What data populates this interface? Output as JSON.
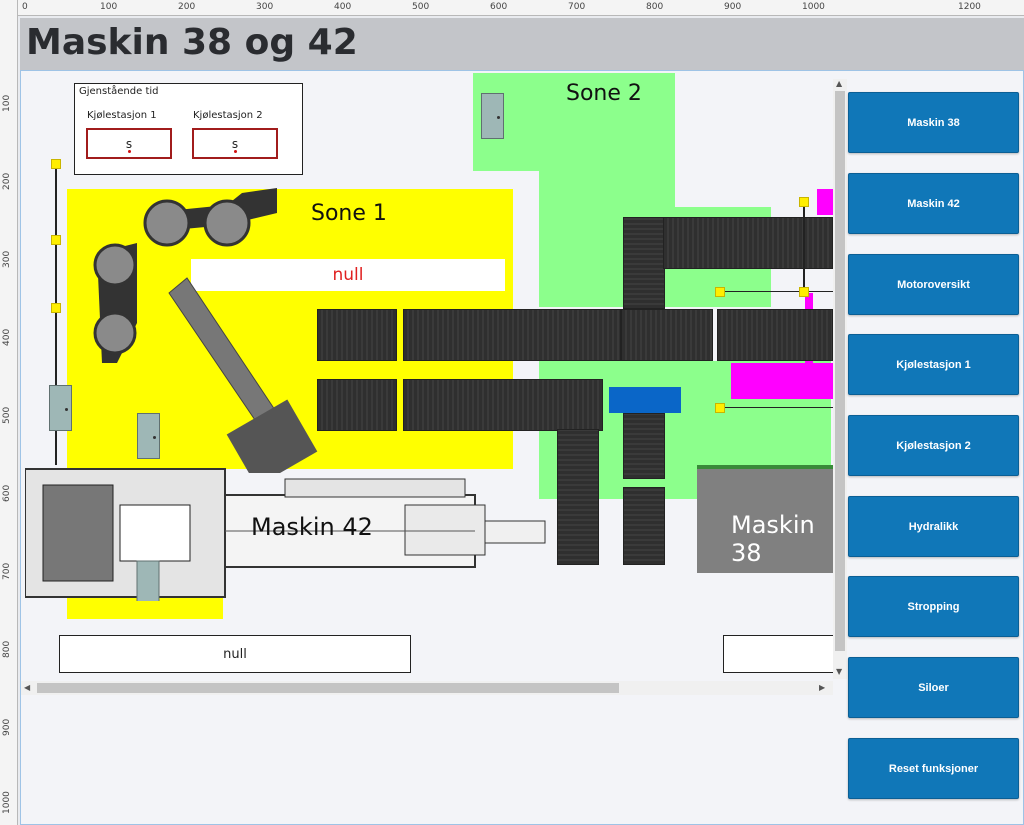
{
  "page": {
    "title": "Maskin 38 og 42"
  },
  "ruler": {
    "top": [
      "0",
      "100",
      "200",
      "300",
      "400",
      "500",
      "600",
      "700",
      "800",
      "900",
      "1000",
      "1200"
    ],
    "left": [
      "100",
      "200",
      "300",
      "400",
      "500",
      "600",
      "700",
      "800",
      "900",
      "1000"
    ]
  },
  "zones": {
    "sone1": "Sone 1",
    "sone2": "Sone 2"
  },
  "timers": {
    "title": "Gjenstående tid",
    "station1_label": "Kjølestasjon 1",
    "station2_label": "Kjølestasjon 2",
    "station1_value": "s",
    "station2_value": "s"
  },
  "status": {
    "sone1_text": "null",
    "bottom_left_text": "null"
  },
  "machines": {
    "m42": "Maskin 42",
    "m38": "Maskin 38"
  },
  "nav": [
    {
      "label": "Maskin 38"
    },
    {
      "label": "Maskin 42"
    },
    {
      "label": "Motoroversikt"
    },
    {
      "label": "Kjølestasjon 1"
    },
    {
      "label": "Kjølestasjon 2"
    },
    {
      "label": "Hydralikk"
    },
    {
      "label": "Stropping"
    },
    {
      "label": "Siloer"
    },
    {
      "label": "Reset funksjoner"
    }
  ],
  "colors": {
    "yellow_zone": "#ffff00",
    "green_zone": "#8cff8c",
    "magenta": "#ff00ff",
    "blue_block": "#0a66c8",
    "button": "#1077b8",
    "null_text_red": "#e02020"
  }
}
